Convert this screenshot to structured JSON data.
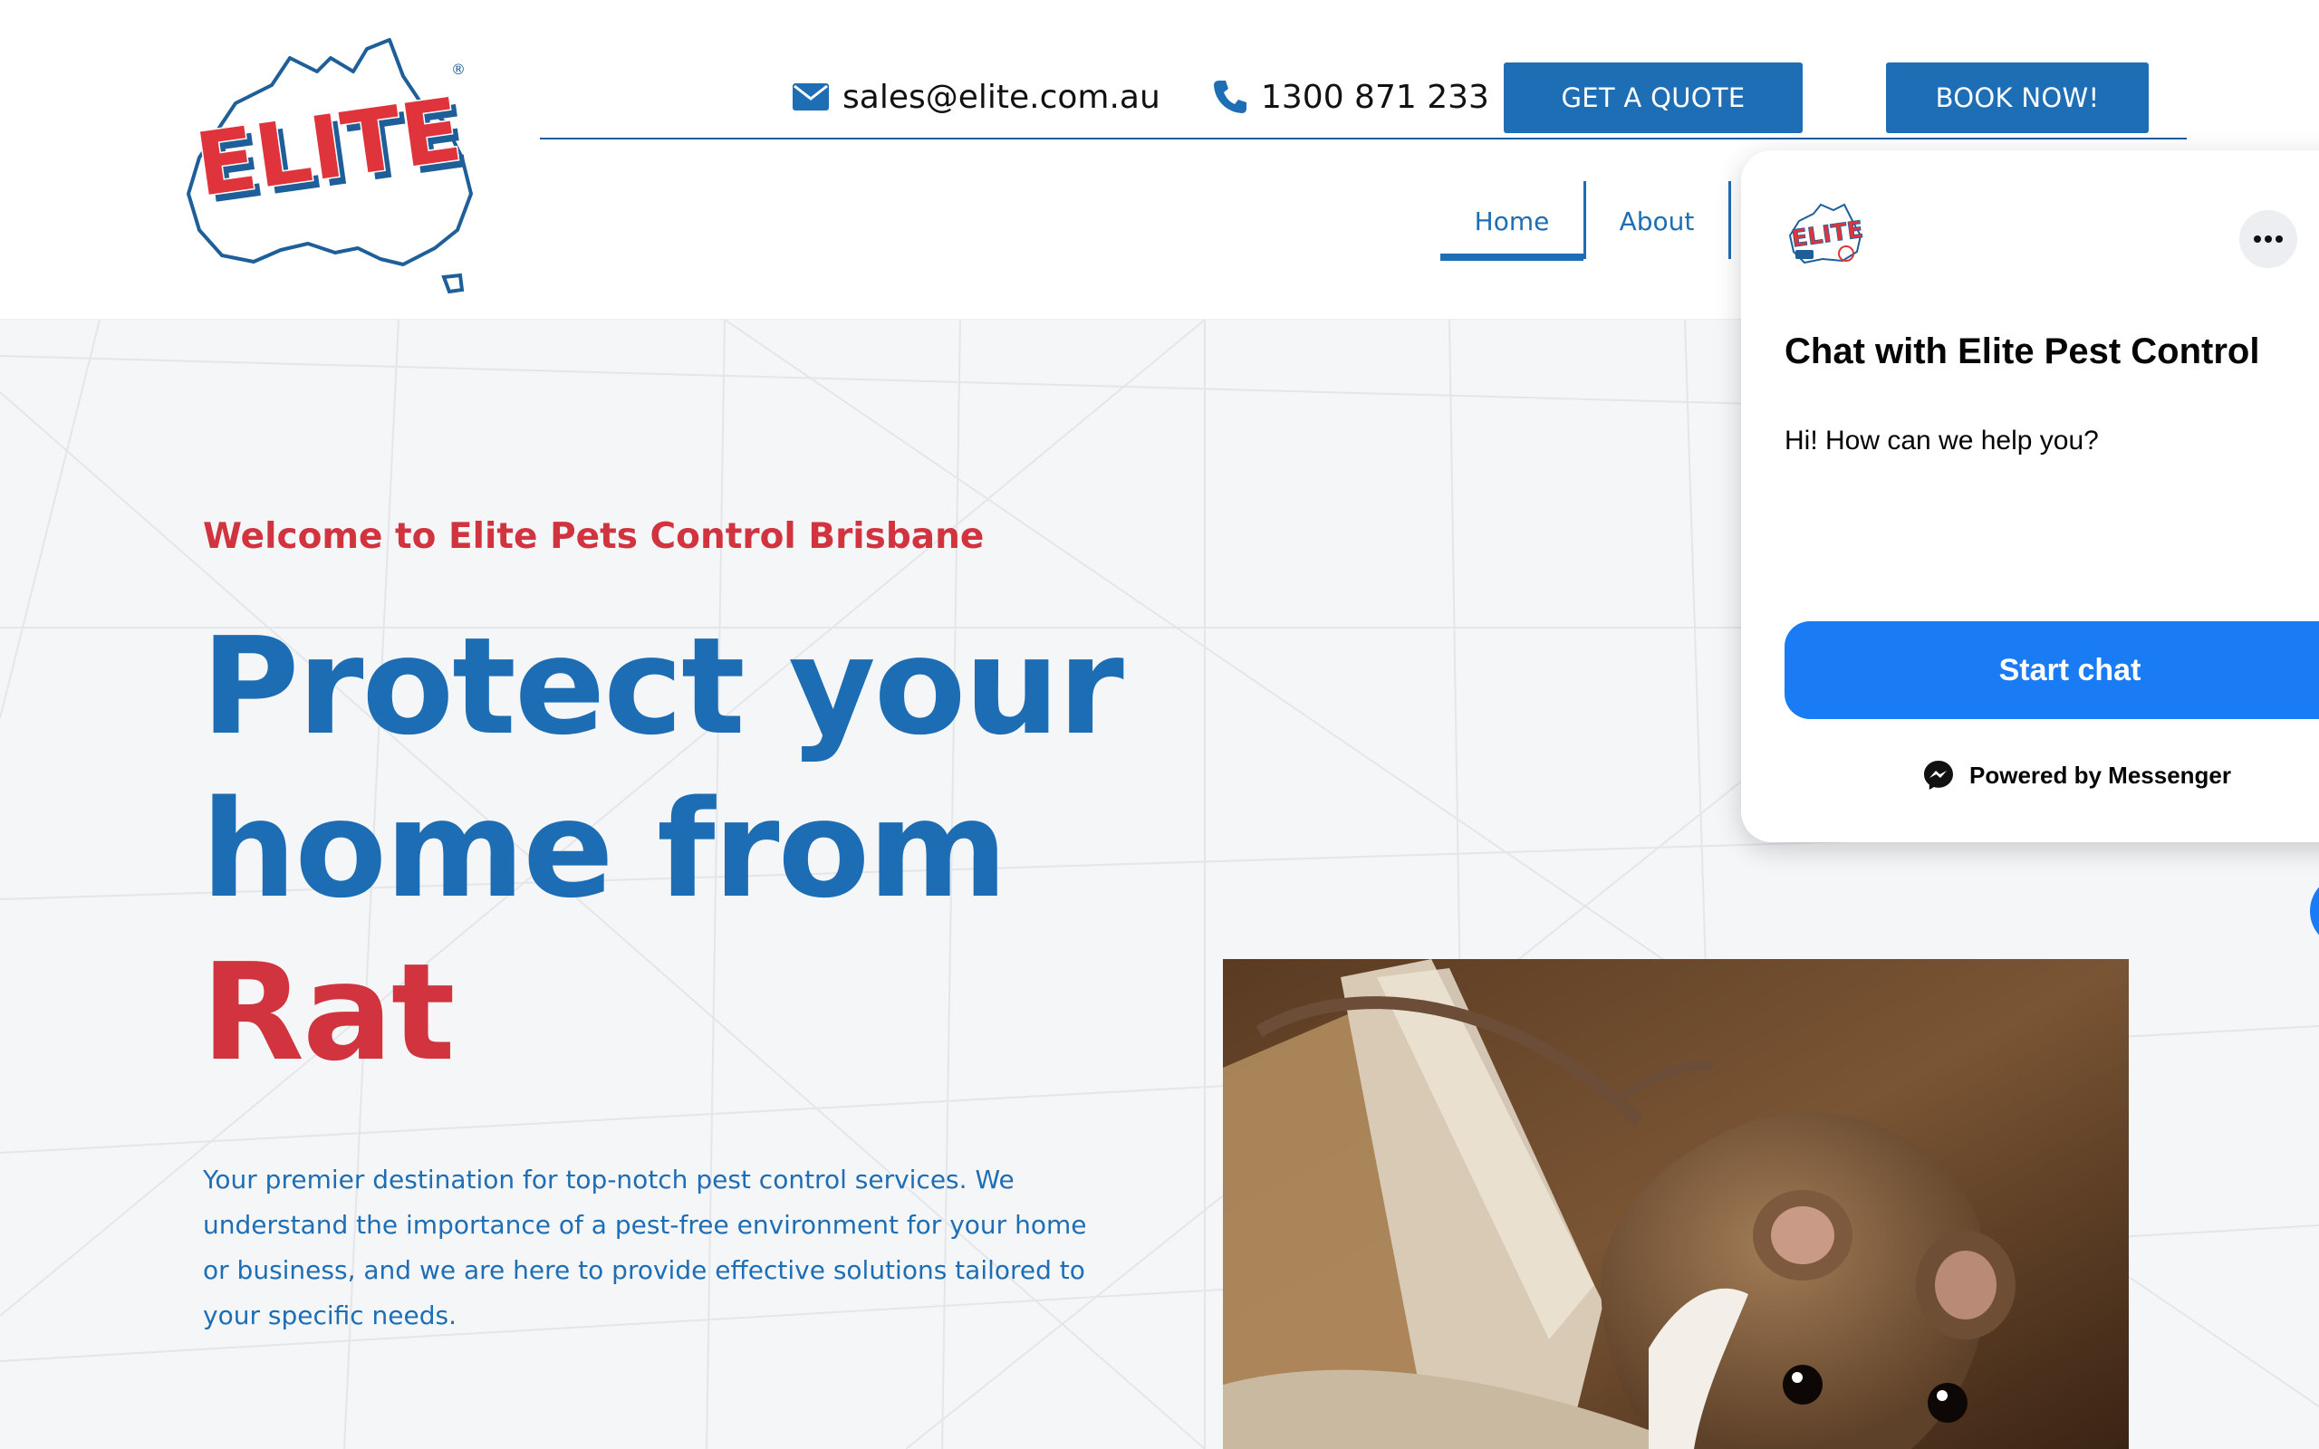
{
  "header": {
    "logo_text": "ELITE",
    "logo_mark": "®",
    "email": "sales@elite.com.au",
    "phone": "1300 871 233",
    "quote_button": "GET A QUOTE",
    "book_button": "BOOK NOW!",
    "nav": [
      {
        "label": "Home",
        "active": true
      },
      {
        "label": "About",
        "active": false
      }
    ],
    "icons": {
      "email": "envelope-icon",
      "phone": "phone-icon"
    }
  },
  "hero": {
    "welcome": "Welcome to Elite Pets Control Brisbane",
    "headline_line1": "Protect your",
    "headline_line2": "home from",
    "headline_line3": "Rat",
    "description": "Your premier destination for top-notch pest control services. We understand the importance of a pest-free environment for your home or business, and we are here to provide effective solutions tailored to your specific needs."
  },
  "chat": {
    "title": "Chat with Elite Pest Control",
    "greeting": "Hi! How can we help you?",
    "start_button": "Start chat",
    "powered_by": "Powered by Messenger",
    "more_icon": "more-options-icon",
    "logo_icon": "elite-logo-icon"
  },
  "colors": {
    "brand_blue": "#1e6eb5",
    "brand_red": "#d1343e",
    "messenger_blue": "#1a7cf5"
  }
}
